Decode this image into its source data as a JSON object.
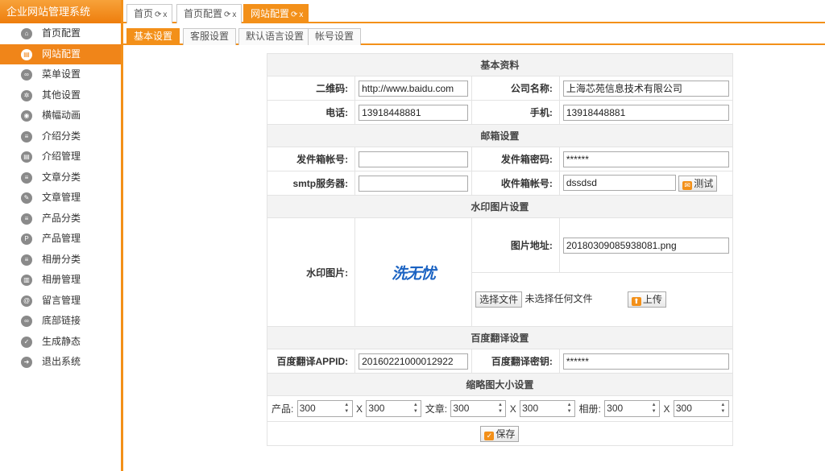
{
  "brand": {
    "title": "企业网站管理系统"
  },
  "sidebar": {
    "items": [
      {
        "label": "首页配置",
        "icon": "home-icon",
        "glyph": "⌂"
      },
      {
        "label": "网站配置",
        "icon": "website-icon",
        "glyph": "▤",
        "active": true
      },
      {
        "label": "菜单设置",
        "icon": "link-icon",
        "glyph": "∞"
      },
      {
        "label": "其他设置",
        "icon": "gear-icon",
        "glyph": "✲"
      },
      {
        "label": "横幅动画",
        "icon": "camera-icon",
        "glyph": "◉"
      },
      {
        "label": "介绍分类",
        "icon": "list-icon",
        "glyph": "≡"
      },
      {
        "label": "介绍管理",
        "icon": "document-icon",
        "glyph": "▤"
      },
      {
        "label": "文章分类",
        "icon": "list-icon",
        "glyph": "≡"
      },
      {
        "label": "文章管理",
        "icon": "edit-icon",
        "glyph": "✎"
      },
      {
        "label": "产品分类",
        "icon": "list-icon",
        "glyph": "≡"
      },
      {
        "label": "产品管理",
        "icon": "p-icon",
        "glyph": "P"
      },
      {
        "label": "相册分类",
        "icon": "list-icon",
        "glyph": "≡"
      },
      {
        "label": "相册管理",
        "icon": "album-icon",
        "glyph": "▥"
      },
      {
        "label": "留言管理",
        "icon": "at-icon",
        "glyph": "@"
      },
      {
        "label": "底部链接",
        "icon": "link-icon",
        "glyph": "∞"
      },
      {
        "label": "生成静态",
        "icon": "check-icon",
        "glyph": "✓"
      },
      {
        "label": "退出系统",
        "icon": "arrow-right-icon",
        "glyph": "➜"
      }
    ]
  },
  "page_tabs": [
    {
      "label": "首页"
    },
    {
      "label": "首页配置"
    },
    {
      "label": "网站配置",
      "active": true
    }
  ],
  "tab_controls": {
    "refresh": "⟳",
    "close": "x"
  },
  "sub_tabs": [
    {
      "label": "基本设置",
      "active": true
    },
    {
      "label": "客服设置"
    },
    {
      "label": "默认语言设置"
    },
    {
      "label": "帐号设置"
    }
  ],
  "form": {
    "basic": {
      "header": "基本资料",
      "qrcode_label": "二维码:",
      "qrcode_value": "http://www.baidu.com",
      "company_label": "公司名称:",
      "company_value": "上海芯苑信息技术有限公司",
      "phone_label": "电话:",
      "phone_value": "13918448881",
      "mobile_label": "手机:",
      "mobile_value": "13918448881"
    },
    "mail": {
      "header": "邮箱设置",
      "sender_account_label": "发件箱帐号:",
      "sender_account_value": "",
      "sender_password_label": "发件箱密码:",
      "sender_password_value": "******",
      "smtp_label": "smtp服务器:",
      "smtp_value": "",
      "receiver_label": "收件箱帐号:",
      "receiver_value": "dssdsd",
      "test_button": "测试"
    },
    "watermark": {
      "header": "水印图片设置",
      "image_label": "水印图片:",
      "logo_text": "洗无忧",
      "path_label": "图片地址:",
      "path_value": "20180309085938081.png",
      "choose_file_button": "选择文件",
      "no_file_text": "未选择任何文件",
      "upload_button": "上传"
    },
    "baidu": {
      "header": "百度翻译设置",
      "appid_label": "百度翻译APPID:",
      "appid_value": "20160221000012922",
      "key_label": "百度翻译密钥:",
      "key_value": "******"
    },
    "thumb": {
      "header": "缩略图大小设置",
      "product_label": "产品:",
      "product_w": "300",
      "product_h": "300",
      "article_label": "文章:",
      "article_w": "300",
      "article_h": "300",
      "album_label": "相册:",
      "album_w": "300",
      "album_h": "300",
      "x_sep": "X"
    },
    "save_button": "保存"
  },
  "colors": {
    "accent": "#f39019",
    "active_nav": "#f08519",
    "logo_blue": "#1a62c2"
  }
}
